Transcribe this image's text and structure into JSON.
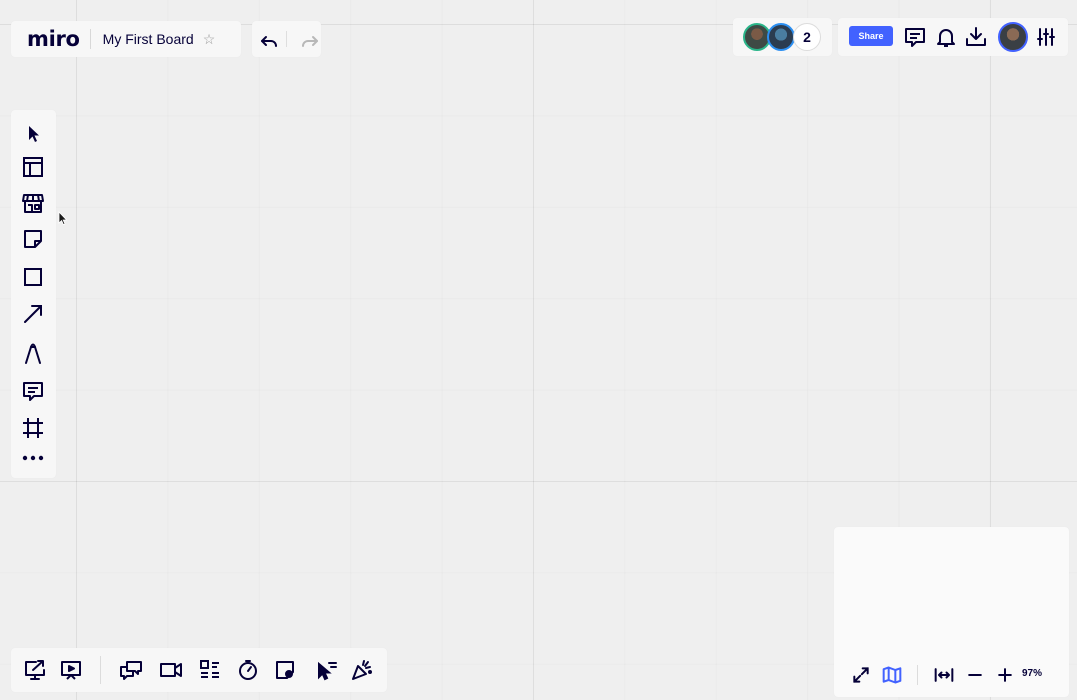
{
  "header": {
    "logo": "miro",
    "board_title": "My First Board",
    "star_icon": "star-outline-icon"
  },
  "history": {
    "undo_icon": "undo-icon",
    "redo_icon": "redo-icon"
  },
  "collaborators": {
    "count": "2"
  },
  "actions": {
    "share_label": "Share",
    "icons": [
      "comments-icon",
      "bell-icon",
      "download-icon",
      "settings-sliders-icon"
    ]
  },
  "left_toolbar": {
    "tools": [
      "select-cursor-icon",
      "templates-icon",
      "marketplace-icon",
      "sticky-note-icon",
      "rectangle-icon",
      "arrow-icon",
      "pen-icon",
      "comment-icon",
      "frame-icon",
      "more-icon"
    ]
  },
  "bottom_toolbar": {
    "tools": [
      "share-screen-icon",
      "presentation-icon",
      "chat-icon",
      "video-icon",
      "cards-icon",
      "timer-icon",
      "add-frame-icon",
      "bring-everyone-icon",
      "celebrate-icon"
    ]
  },
  "minimap": {
    "zoom_level": "97%",
    "icons": [
      "fullscreen-icon",
      "map-icon",
      "fit-width-icon",
      "zoom-out-icon",
      "zoom-in-icon"
    ]
  },
  "colors": {
    "accent": "#4262ff",
    "ink": "#050038",
    "canvas": "#efefef"
  }
}
